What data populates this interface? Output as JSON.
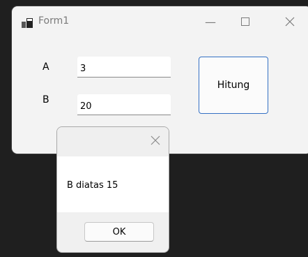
{
  "window": {
    "title": "Form1"
  },
  "form": {
    "label_a": "A",
    "value_a": "3",
    "label_b": "B",
    "value_b": "20",
    "hitung_label": "Hitung"
  },
  "dialog": {
    "message": "B diatas 15",
    "ok_label": "OK"
  },
  "icons": [
    "app-icon",
    "minimize-icon",
    "maximize-icon",
    "close-icon",
    "dialog-close-icon"
  ],
  "colors": {
    "accent": "#3470c4",
    "window_bg": "#f3f3f3",
    "desktop_bg": "#1f1f1f"
  }
}
